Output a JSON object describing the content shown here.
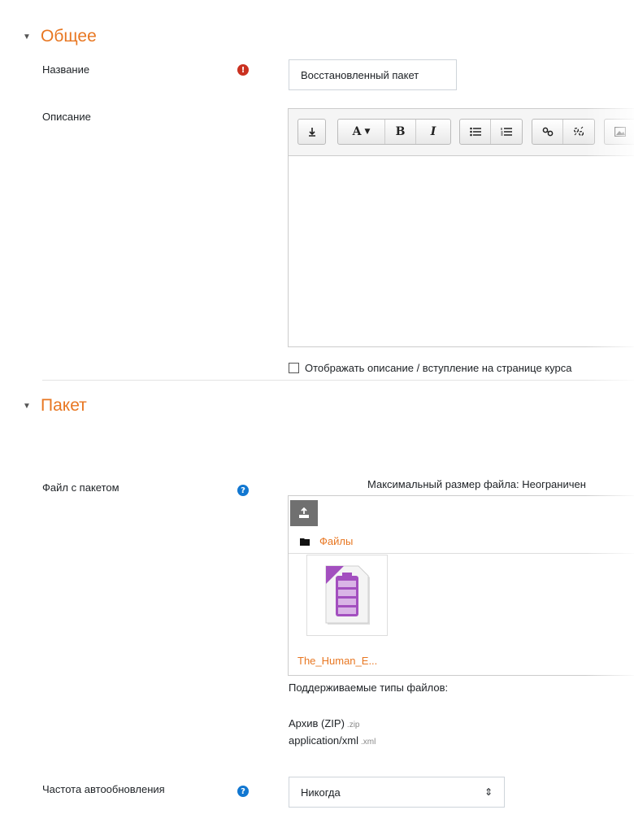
{
  "general": {
    "section_title": "Общее",
    "name_label": "Название",
    "name_value": "Восстановленный пакет",
    "description_label": "Описание",
    "show_description_label": "Отображать описание / вступление на странице курса"
  },
  "package": {
    "section_title": "Пакет",
    "file_label": "Файл с пакетом",
    "max_size_text": "Максимальный размер файла: Неограничен",
    "files_path": "Файлы",
    "file_name": "The_Human_E...",
    "supported_types_label": "Поддерживаемые типы файлов:",
    "file_types": [
      {
        "name": "Архив (ZIP)",
        "ext": ".zip"
      },
      {
        "name": "application/xml",
        "ext": ".xml"
      }
    ],
    "autoupdate_label": "Частота автообновления",
    "autoupdate_value": "Никогда"
  },
  "editor_toolbar": {
    "b_label": "B",
    "i_label": "I",
    "font_label": "A"
  },
  "icons": {
    "required": "!",
    "help": "?",
    "select_arrow": "⇕"
  },
  "colors": {
    "accent": "#e87722",
    "required": "#ca3120",
    "help": "#1177d1",
    "file_icon": "#a34fbf"
  }
}
